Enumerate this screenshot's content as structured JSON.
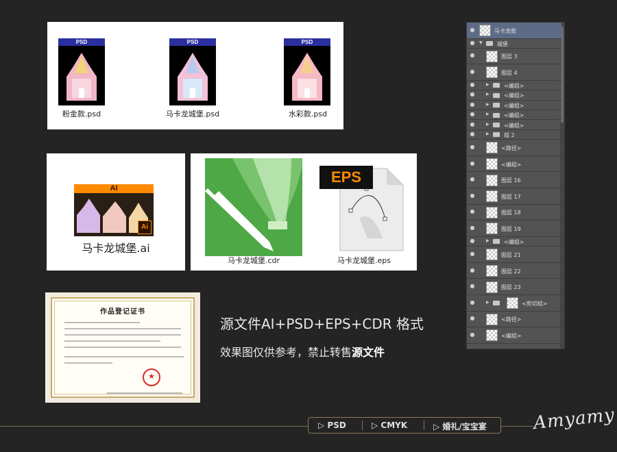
{
  "psd_files": [
    {
      "tag": "PSD",
      "name": "粉金款.psd"
    },
    {
      "tag": "PSD",
      "name": "马卡龙城堡.psd"
    },
    {
      "tag": "PSD",
      "name": "水彩款.psd"
    }
  ],
  "ai_file": {
    "tag": "AI",
    "badge": "Ai",
    "name": "马卡龙城堡.ai"
  },
  "cdr_file": {
    "name": "马卡龙城堡.cdr"
  },
  "eps_file": {
    "tag": "EPS",
    "name": "马卡龙城堡.eps"
  },
  "certificate": {
    "title": "作品登记证书"
  },
  "headline": "源文件AI+PSD+EPS+CDR 格式",
  "subline": {
    "prefix": "效果图仅供参考，禁止转售",
    "bold": "源文件"
  },
  "layers": [
    {
      "name": "马卡龙款",
      "type": "layer",
      "selected": true
    },
    {
      "name": "城堡",
      "type": "group",
      "open": true
    },
    {
      "name": "图层 3",
      "type": "layer"
    },
    {
      "name": "图层 4",
      "type": "layer"
    },
    {
      "name": "<编组>",
      "type": "group"
    },
    {
      "name": "<编组>",
      "type": "group"
    },
    {
      "name": "<编组>",
      "type": "group"
    },
    {
      "name": "<编组>",
      "type": "group"
    },
    {
      "name": "<编组>",
      "type": "group"
    },
    {
      "name": "组 2",
      "type": "group"
    },
    {
      "name": "<路径>",
      "type": "layer"
    },
    {
      "name": "<编组>",
      "type": "layer"
    },
    {
      "name": "图层 16",
      "type": "layer"
    },
    {
      "name": "图层 17",
      "type": "layer"
    },
    {
      "name": "图层 18",
      "type": "layer"
    },
    {
      "name": "图层 19",
      "type": "layer"
    },
    {
      "name": "<编组>",
      "type": "group"
    },
    {
      "name": "图层 21",
      "type": "layer"
    },
    {
      "name": "图层 22",
      "type": "layer"
    },
    {
      "name": "图层 23",
      "type": "layer"
    },
    {
      "name": "<剪切组>",
      "type": "clip"
    },
    {
      "name": "<路径>",
      "type": "layer"
    },
    {
      "name": "<编组>",
      "type": "layer"
    }
  ],
  "tags": [
    "▷ PSD",
    "▷ CMYK",
    "▷ 婚礼/宝宝宴"
  ],
  "signature": "Amyamy",
  "colors": {
    "background": "#242424",
    "ai_orange": "#ff8a00",
    "cdr_green": "#4ea846",
    "psd_blue": "#2b2fa0",
    "gold": "#8a7a58"
  }
}
